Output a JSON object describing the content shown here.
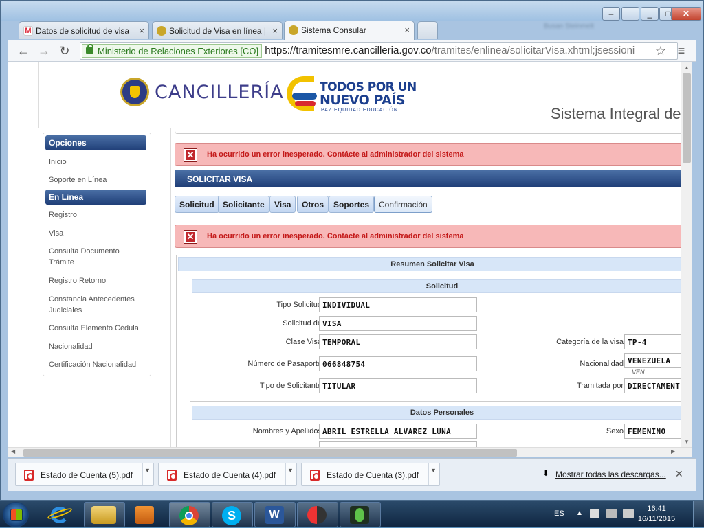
{
  "browser": {
    "tabs": [
      {
        "label": "Datos de solicitud de visa",
        "icon": "gmail-icon"
      },
      {
        "label": "Solicitud de Visa en línea |",
        "icon": "seal-icon"
      },
      {
        "label": "Sistema Consular",
        "icon": "seal-icon"
      }
    ],
    "secure_label": "Ministerio de Relaciones Exteriores [CO]",
    "url_host": "https://tramitesmre.cancilleria.gov.co",
    "url_path": "/tramites/enlinea/solicitarVisa.xhtml;jsessioni",
    "blurred_profile": "Busan Steinmelt"
  },
  "header": {
    "brand": "CANCILLERÍA",
    "slogan_line1": "TODOS POR UN",
    "slogan_line2": "NUEVO PAÍS",
    "slogan_sub": "PAZ  EQUIDAD  EDUCACIÓN",
    "system_title": "Sistema Integral de T"
  },
  "sidebar": {
    "section1": "Opciones",
    "items1": [
      "Inicio",
      "Soporte en Línea"
    ],
    "section2": "En Linea",
    "items2": [
      "Registro",
      "Visa",
      "Consulta Documento Trámite",
      "Registro Retorno",
      "Constancia Antecedentes Judiciales",
      "Consulta Elemento Cédula",
      "Nacionalidad",
      "Certificación Nacionalidad"
    ]
  },
  "errors": {
    "message": "Ha ocurrido un error inesperado. Contácte al administrador del sistema"
  },
  "section_title": "SOLICITAR VISA",
  "steps": [
    "Solicitud",
    "Solicitante",
    "Visa",
    "Otros",
    "Soportes",
    "Confirmación"
  ],
  "summary": {
    "title": "Resumen Solicitar Visa",
    "solicitud_title": "Solicitud",
    "tipo_solicitud_label": "Tipo Solicitud",
    "tipo_solicitud": "INDIVIDUAL",
    "solicitud_de_label": "Solicitud de",
    "solicitud_de": "VISA",
    "clase_visa_label": "Clase Visa",
    "clase_visa": "TEMPORAL",
    "categoria_label": "Categoría de la visa",
    "categoria": "TP-4",
    "pasaporte_label": "Número de Pasaporte",
    "pasaporte": "066848754",
    "nacionalidad_label": "Nacionalidad",
    "nacionalidad": "VENEZUELA",
    "nacionalidad_code": "VEN",
    "tipo_solicitante_label": "Tipo de Solicitante",
    "tipo_solicitante": "TITULAR",
    "tramitada_label": "Tramitada por",
    "tramitada": "DIRECTAMENT",
    "personales_title": "Datos Personales",
    "nombres_label": "Nombres y Apellidos",
    "nombres": "ABRIL ESTRELLA ALVAREZ LUNA",
    "sexo_label": "Sexo",
    "sexo": "FEMENINO"
  },
  "downloads": {
    "items": [
      "Estado de Cuenta (5).pdf",
      "Estado de Cuenta (4).pdf",
      "Estado de Cuenta (3).pdf"
    ],
    "show_all": "Mostrar todas las descargas..."
  },
  "taskbar": {
    "lang": "ES",
    "time": "16:41",
    "date": "16/11/2015"
  }
}
